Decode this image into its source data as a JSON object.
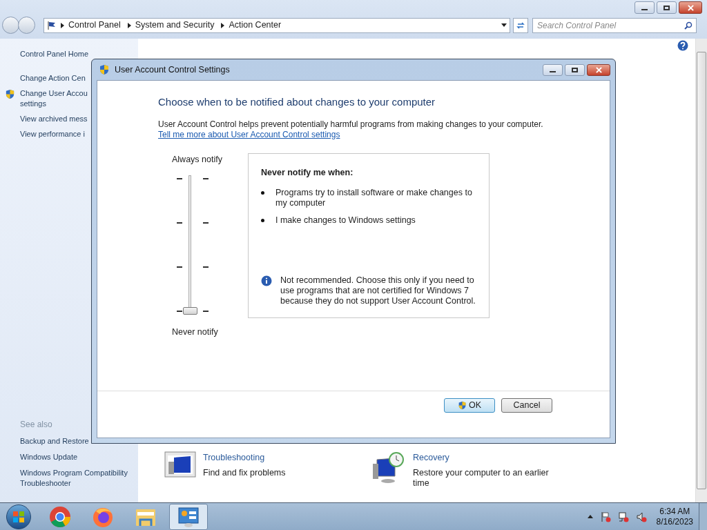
{
  "explorer": {
    "breadcrumb": [
      "Control Panel",
      "System and Security",
      "Action Center"
    ],
    "search": {
      "placeholder": "Search Control Panel"
    }
  },
  "sidebar": {
    "items": [
      {
        "label": "Control Panel Home",
        "shield": false
      },
      {
        "label": "Change Action Cen",
        "shield": false
      },
      {
        "label": "Change User Accou",
        "label2": "settings",
        "shield": true
      },
      {
        "label": "View archived mess",
        "shield": false
      },
      {
        "label": "View performance i",
        "shield": false
      }
    ],
    "see_also_title": "See also",
    "see_also": [
      "Backup and Restore",
      "Windows Update",
      "Windows Program Compatibility Troubleshooter"
    ]
  },
  "tiles": [
    {
      "kind": "troubleshooting",
      "title": "Troubleshooting",
      "text": "Find and fix problems"
    },
    {
      "kind": "recovery",
      "title": "Recovery",
      "text": "Restore your computer to an earlier time"
    }
  ],
  "dialog": {
    "title": "User Account Control Settings",
    "heading": "Choose when to be notified about changes to your computer",
    "description": "User Account Control helps prevent potentially harmful programs from making changes to your computer.",
    "link": "Tell me more about User Account Control settings",
    "slider": {
      "top_label": "Always notify",
      "bottom_label": "Never notify",
      "level": 0
    },
    "info_title": "Never notify me when:",
    "bullets": [
      "Programs try to install software or make changes to my computer",
      "I make changes to Windows settings"
    ],
    "note": "Not recommended. Choose this only if you need to use programs that are not certified for Windows 7 because they do not support User Account Control.",
    "buttons": [
      {
        "label": "OK",
        "kind": "primary"
      },
      {
        "label": "Cancel",
        "kind": "secondary"
      }
    ]
  },
  "taskbar": {
    "apps": [
      {
        "kind": "chrome",
        "active": false
      },
      {
        "kind": "firefox",
        "active": false
      },
      {
        "kind": "explorer",
        "active": false
      },
      {
        "kind": "control-panel",
        "active": true
      }
    ],
    "time": "6:34 AM",
    "date": "8/16/2023"
  }
}
